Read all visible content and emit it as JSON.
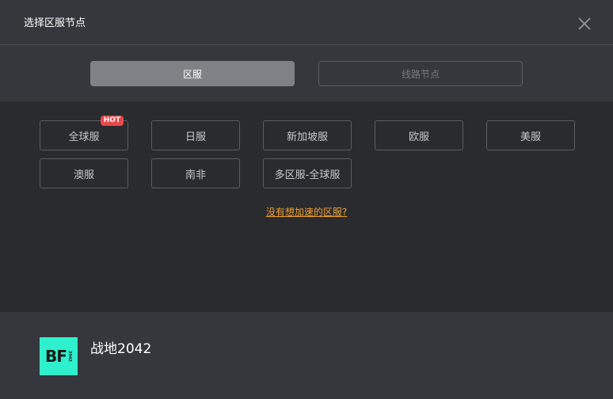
{
  "header": {
    "title": "选择区服节点"
  },
  "tabs": {
    "region_label": "区服",
    "node_label": "线路节点"
  },
  "regions": [
    {
      "label": "全球服",
      "badge": "HOT"
    },
    {
      "label": "日服"
    },
    {
      "label": "新加坡服"
    },
    {
      "label": "欧服"
    },
    {
      "label": "美服"
    },
    {
      "label": "澳服"
    },
    {
      "label": "南非"
    },
    {
      "label": "多区服-全球服"
    }
  ],
  "missing_link": "没有想加速的区服?",
  "game": {
    "name": "战地2042",
    "logo_text": "BF",
    "logo_sub": "2042"
  },
  "colors": {
    "accent_link": "#f0a030",
    "hot_badge": "#e8494a",
    "logo_bg": "#2ff0cd"
  }
}
